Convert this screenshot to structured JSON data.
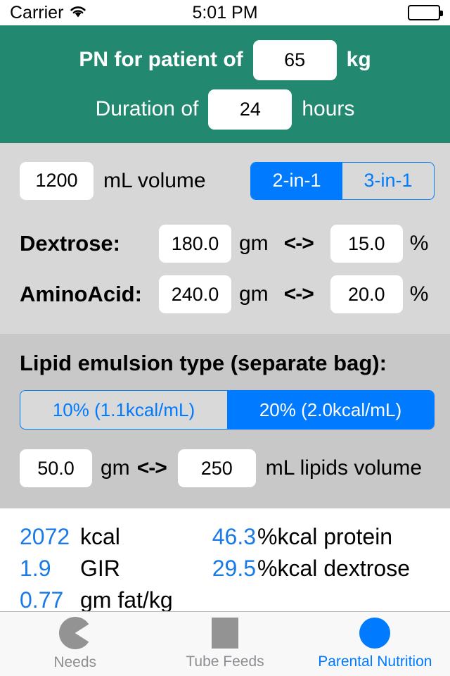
{
  "statusbar": {
    "carrier": "Carrier",
    "time": "5:01 PM",
    "wifi_icon": "wifi-icon",
    "battery_icon": "battery-full-icon"
  },
  "header": {
    "patient_label": "PN for patient of",
    "weight_value": "65",
    "weight_unit": "kg",
    "duration_label": "Duration of",
    "duration_value": "24",
    "duration_unit": "hours",
    "background_color": "#22886f"
  },
  "volume": {
    "value": "1200",
    "label": "mL volume",
    "mix_options": [
      "2-in-1",
      "3-in-1"
    ],
    "mix_selected": "2-in-1"
  },
  "macros": [
    {
      "name": "Dextrose:",
      "grams": "180.0",
      "grams_unit": "gm",
      "arrow": "<->",
      "percent": "15.0",
      "percent_unit": "%"
    },
    {
      "name": "AminoAcid:",
      "grams": "240.0",
      "grams_unit": "gm",
      "arrow": "<->",
      "percent": "20.0",
      "percent_unit": "%"
    }
  ],
  "lipids": {
    "title": "Lipid emulsion type (separate bag):",
    "options": [
      "10% (1.1kcal/mL)",
      "20% (2.0kcal/mL)"
    ],
    "selected": "20% (2.0kcal/mL)",
    "grams": "50.0",
    "grams_unit": "gm",
    "arrow": "<->",
    "volume": "250",
    "volume_label": "mL lipids volume"
  },
  "results": [
    {
      "value": "2072",
      "label": "kcal",
      "value2": "46.3",
      "label2": "%kcal protein"
    },
    {
      "value": "1.9",
      "label": "GIR",
      "value2": "29.5",
      "label2": "%kcal dextrose"
    },
    {
      "value": "0.77",
      "label": "gm fat/kg",
      "value2": "",
      "label2": ""
    }
  ],
  "tabbar": {
    "items": [
      {
        "label": "Needs",
        "icon": "pac-chart-icon",
        "active": false
      },
      {
        "label": "Tube Feeds",
        "icon": "square-icon",
        "active": false
      },
      {
        "label": "Parental Nutrition",
        "icon": "circle-icon",
        "active": true
      }
    ]
  },
  "colors": {
    "teal": "#22886f",
    "accent_blue": "#007aff",
    "result_blue": "#1a7ae8",
    "section_light": "#d7d7d7",
    "section_dark": "#c8c8c8"
  }
}
